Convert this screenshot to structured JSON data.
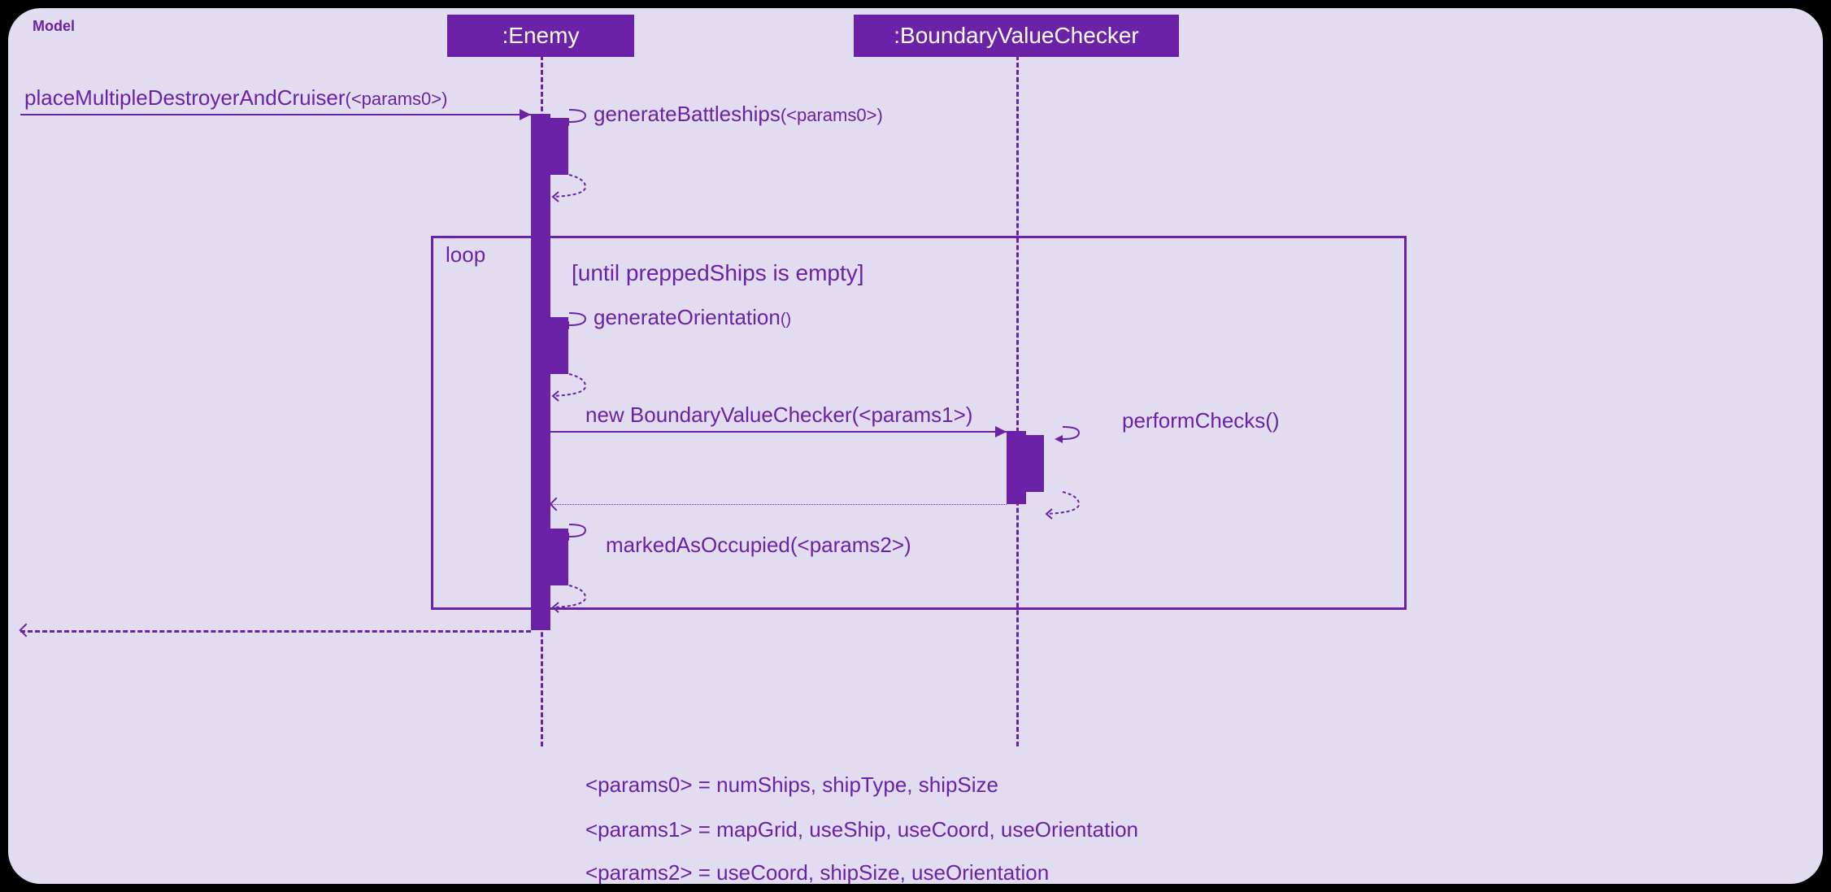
{
  "frame": {
    "label": "Model"
  },
  "lifelines": {
    "enemy": ":Enemy",
    "bvc": ":BoundaryValueChecker"
  },
  "messages": {
    "entry": "placeMultipleDestroyerAndCruiser",
    "entry_params": "(<params0>)",
    "gen_battleships": "generateBattleships",
    "gen_battleships_params": "(<params0>)",
    "gen_orientation": "generateOrientation",
    "gen_orientation_params": "()",
    "new_bvc": "new BoundaryValueChecker(<params1>)",
    "perform_checks": "performChecks()",
    "marked_occupied": "markedAsOccupied(<params2>)"
  },
  "loop": {
    "label": "loop",
    "guard": "[until preppedShips is empty]"
  },
  "footnotes": {
    "p0": "<params0>  = numShips, shipType, shipSize",
    "p1": "<params1> =  mapGrid, useShip, useCoord, useOrientation",
    "p2": "<params2> =  useCoord, shipSize, useOrientation"
  }
}
